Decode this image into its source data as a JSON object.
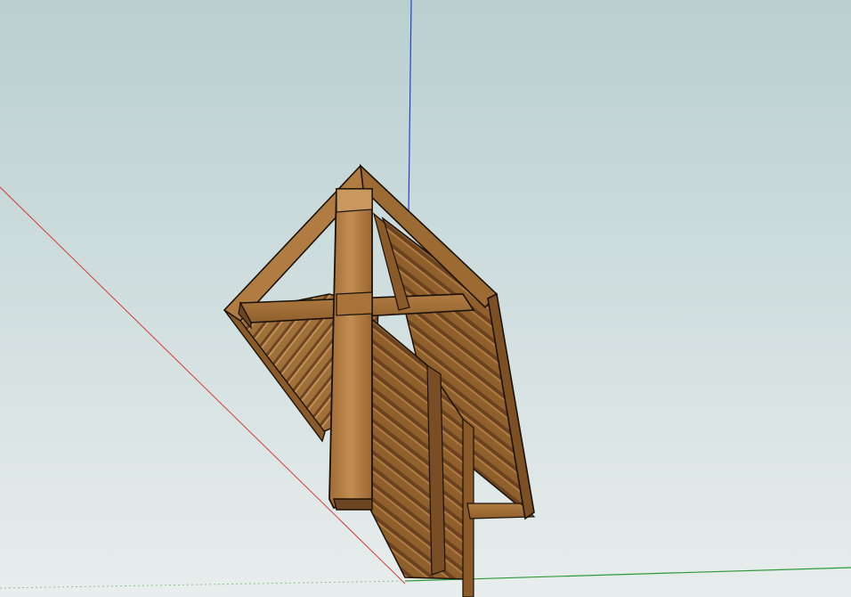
{
  "colors": {
    "sky_top": "#b9cfd0",
    "sky_bottom": "#e8eded",
    "wood_light": "#b07c42",
    "wood_mid": "#8f5f2c",
    "wood_dark": "#5e3b17",
    "edge": "#1a1208",
    "axis_red": "#d33b3b",
    "axis_green": "#2f9a3a",
    "axis_blue": "#2a3fd0"
  },
  "icons": [
    "red-axis",
    "green-axis",
    "blue-axis"
  ]
}
